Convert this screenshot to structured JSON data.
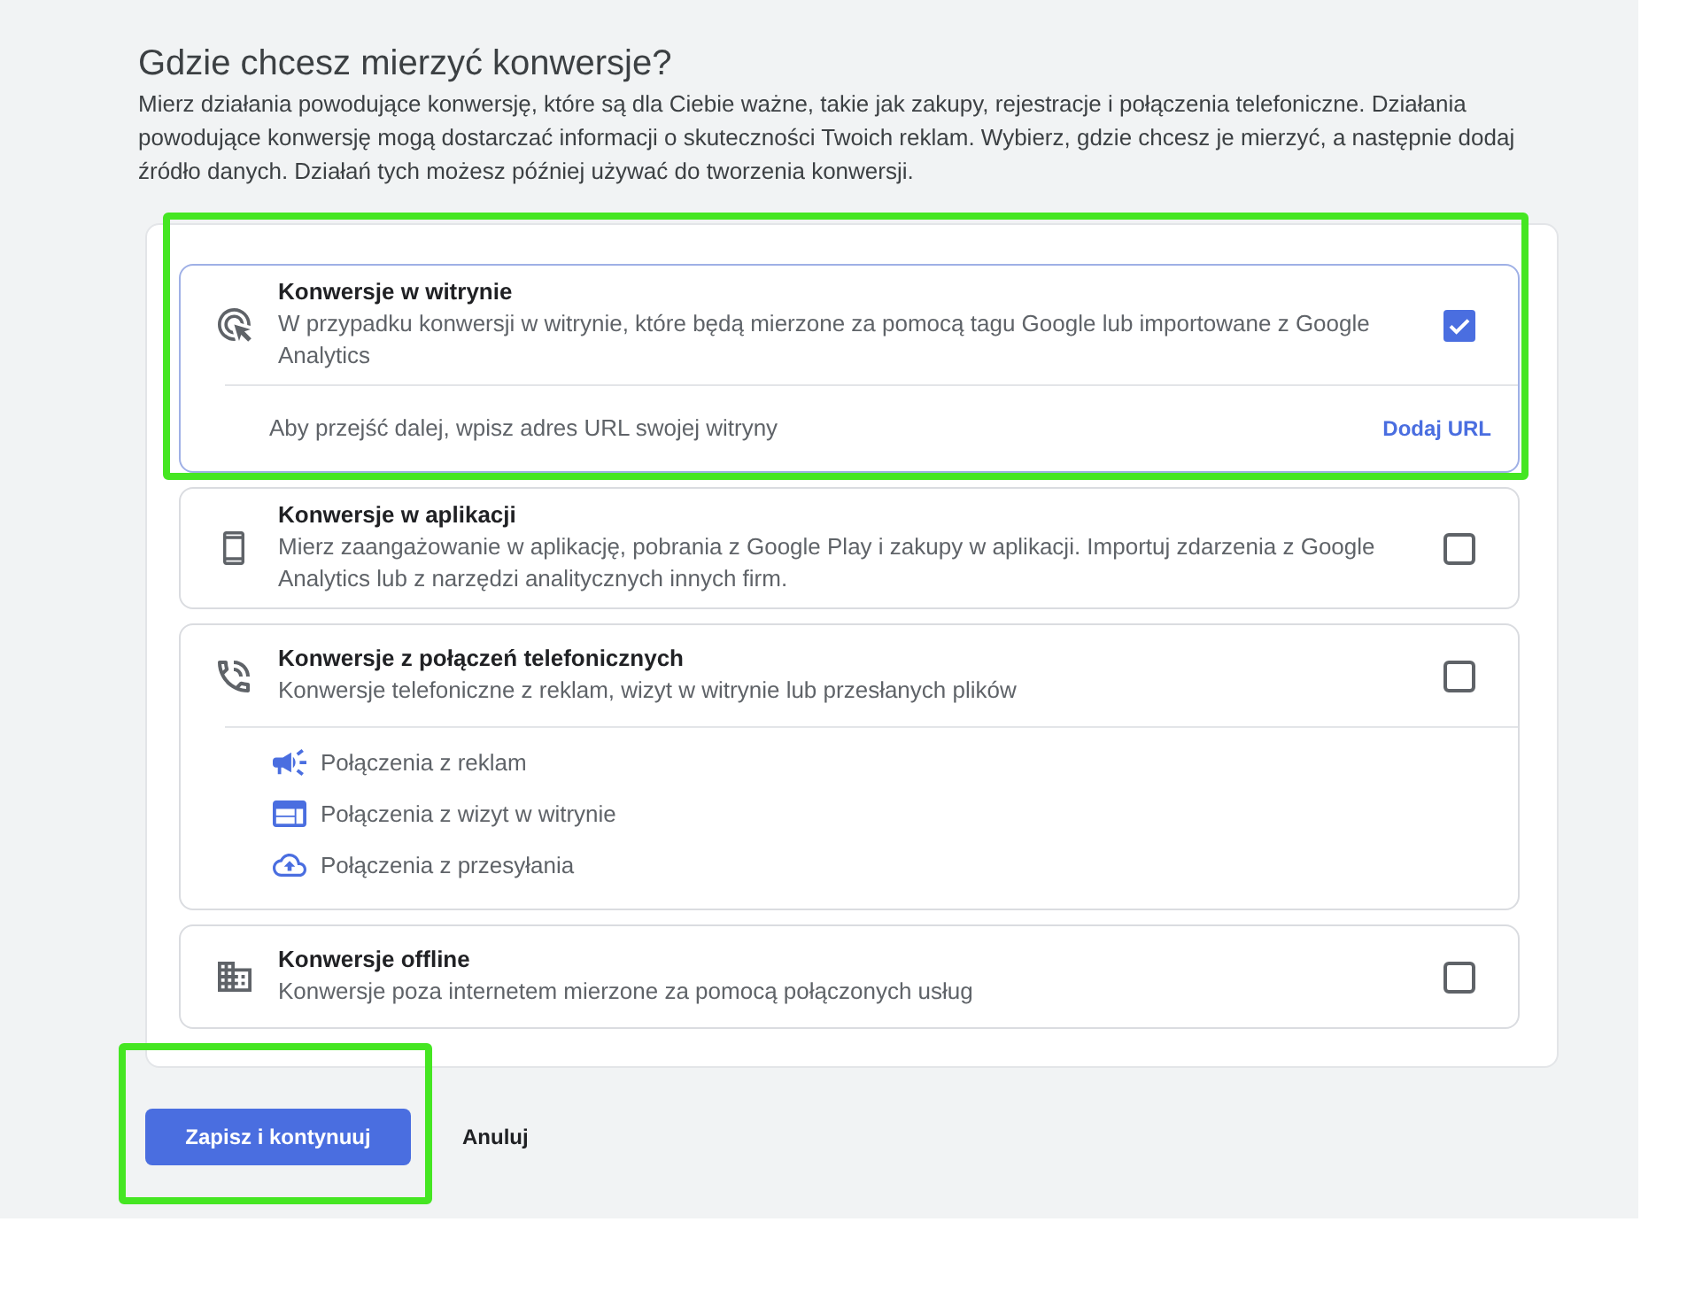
{
  "title": "Gdzie chcesz mierzyć konwersje?",
  "description": "Mierz działania powodujące konwersję, które są dla Ciebie ważne, takie jak zakupy, rejestracje i połączenia telefoniczne. Działania powodujące konwersję mogą dostarczać informacji o skuteczności Twoich reklam. Wybierz, gdzie chcesz je mierzyć, a następnie dodaj źródło danych. Działań tych możesz później używać do tworzenia konwersji.",
  "options": [
    {
      "kind": "website",
      "title": "Konwersje w witrynie",
      "description": "W przypadku konwersji w witrynie, które będą mierzone za pomocą tagu Google lub importowane z Google Analytics",
      "checked": true,
      "highlighted": true,
      "footer": {
        "text": "Aby przejść dalej, wpisz adres URL swojej witryny",
        "link": "Dodaj URL"
      }
    },
    {
      "kind": "app",
      "title": "Konwersje w aplikacji",
      "description": "Mierz zaangażowanie w aplikację, pobrania z Google Play i zakupy w aplikacji. Importuj zdarzenia z Google Analytics lub z narzędzi analitycznych innych firm.",
      "checked": false,
      "highlighted": false
    },
    {
      "kind": "phone",
      "title": "Konwersje z połączeń telefonicznych",
      "description": "Konwersje telefoniczne z reklam, wizyt w witrynie lub przesłanych plików",
      "checked": false,
      "highlighted": false,
      "sub_items": [
        {
          "kind": "ads",
          "label": "Połączenia z reklam"
        },
        {
          "kind": "website",
          "label": "Połączenia z wizyt w witrynie"
        },
        {
          "kind": "upload",
          "label": "Połączenia z przesyłania"
        }
      ]
    },
    {
      "kind": "offline",
      "title": "Konwersje offline",
      "description": "Konwersje poza internetem mierzone za pomocą połączonych usług",
      "checked": false,
      "highlighted": false
    }
  ],
  "buttons": [
    {
      "kind": "primary",
      "label": "Zapisz i kontynuuj",
      "highlighted": true
    },
    {
      "kind": "text",
      "label": "Anuluj",
      "highlighted": false
    }
  ]
}
